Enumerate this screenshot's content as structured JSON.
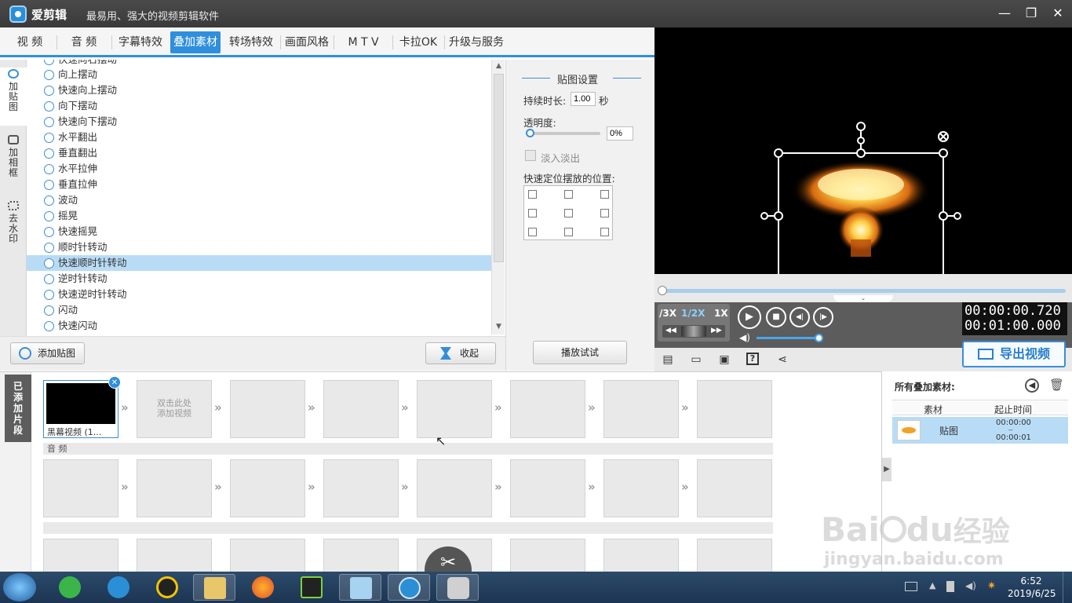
{
  "app": {
    "name": "爱剪辑",
    "slogan": "最易用、强大的视频剪辑软件"
  },
  "window_controls": {
    "minimize": "—",
    "maximize": "❐",
    "close": "✕"
  },
  "tabs": [
    "视 频",
    "音 频",
    "字幕特效",
    "叠加素材",
    "转场特效",
    "画面风格",
    "M T V",
    "卡拉OK",
    "升级与服务"
  ],
  "active_tab": "叠加素材",
  "left_tools": [
    {
      "label": "加\n贴\n图",
      "active": true
    },
    {
      "label": "加\n相\n框",
      "active": false
    },
    {
      "label": "去\n水\n印",
      "active": false
    }
  ],
  "effects": {
    "partial_top": "快速向右摆动",
    "items": [
      "向上摆动",
      "快速向上摆动",
      "向下摆动",
      "快速向下摆动",
      "水平翻出",
      "垂直翻出",
      "水平拉伸",
      "垂直拉伸",
      "波动",
      "摇晃",
      "快速摇晃",
      "顺时针转动",
      "快速顺时针转动",
      "逆时针转动",
      "快速逆时针转动",
      "闪动",
      "快速闪动"
    ],
    "selected": "快速顺时针转动"
  },
  "panel_buttons": {
    "add_sticker": "添加贴图",
    "collapse": "收起",
    "preview": "播放试试"
  },
  "sticker_settings": {
    "title": "贴图设置",
    "duration_label": "持续时长:",
    "duration_value": "1.00",
    "duration_unit": "秒",
    "opacity_label": "透明度:",
    "opacity_value": "0%",
    "opacity_level": 0,
    "fade_label": "淡入淡出",
    "fade_checked": false,
    "position_label": "快速定位摆放的位置:"
  },
  "player": {
    "speeds": [
      "/3X",
      "1/2X",
      "1X"
    ],
    "active_speed": "1/2X",
    "current_time": "00:00:00.720",
    "total_time": "00:01:00.000",
    "progress": 0.01,
    "volume": 0.95,
    "export_label": "导出视频"
  },
  "timeline": {
    "side_tab": "已\n添\n加\n片\n段",
    "first_clip_label": "黑幕视频 (1...",
    "add_hint": "双击此处\n添加视频",
    "audio_label": "音 频"
  },
  "overlay_list": {
    "title": "所有叠加素材:",
    "col_material": "素材",
    "col_time": "起止时间",
    "items": [
      {
        "name": "贴图",
        "start": "00:00:00",
        "sep": "--",
        "end": "00:00:01"
      }
    ]
  },
  "watermark": {
    "brand": "Bai",
    "brand2": "du",
    "jingyan": "经验",
    "url": "jingyan.baidu.com"
  },
  "taskbar": {
    "time": "6:52",
    "date": "2019/6/25"
  },
  "colors": {
    "accent": "#2f8fdc",
    "selection": "#b9dcf6",
    "titlebar": "#3f3f3f"
  }
}
